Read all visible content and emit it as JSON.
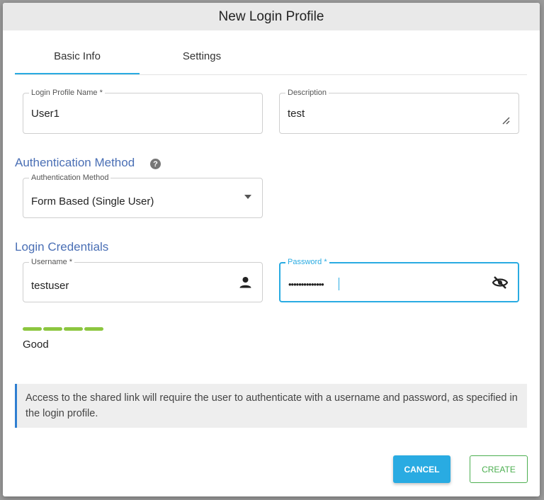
{
  "dialog": {
    "title": "New Login Profile"
  },
  "tabs": [
    {
      "label": "Basic Info",
      "active": true
    },
    {
      "label": "Settings",
      "active": false
    }
  ],
  "fields": {
    "profile_name": {
      "label": "Login Profile Name *",
      "value": "User1"
    },
    "description": {
      "label": "Description",
      "value": "test"
    },
    "auth_method": {
      "label": "Authentication Method",
      "value": "Form Based (Single User)"
    },
    "username": {
      "label": "Username *",
      "value": "testuser"
    },
    "password": {
      "label": "Password *",
      "value": "••••••••••••••"
    }
  },
  "sections": {
    "auth": {
      "title": "Authentication Method",
      "help_icon": "question-circle-icon"
    },
    "credentials": {
      "title": "Login Credentials"
    }
  },
  "password_strength": {
    "label": "Good",
    "segments_filled": 4,
    "segments_total": 4,
    "color": "#8cc63f"
  },
  "info": {
    "text": "Access to the shared link will require the user to authenticate with a username and password, as specified in the login profile."
  },
  "buttons": {
    "cancel": "CANCEL",
    "create": "CREATE"
  },
  "colors": {
    "accent": "#29abe2",
    "section_title": "#4a6fb5",
    "create": "#4caf50"
  }
}
